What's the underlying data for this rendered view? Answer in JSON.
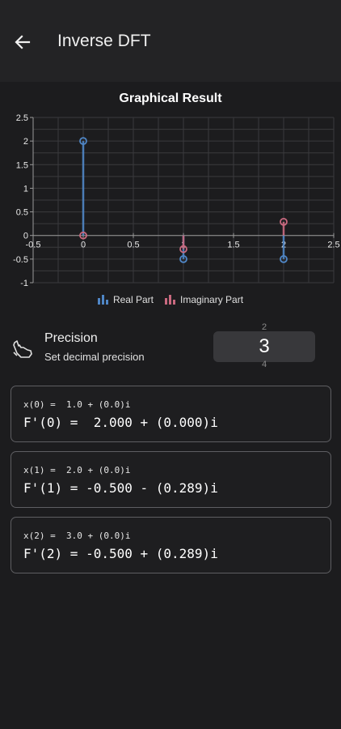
{
  "app_bar": {
    "title": "Inverse DFT",
    "back_icon": "arrow-left-icon"
  },
  "chart_section": {
    "title": "Graphical Result"
  },
  "chart_data": {
    "type": "scatter",
    "title": "Graphical Result",
    "x_ticks": [
      "-0.5",
      "0",
      "0.5",
      "1",
      "1.5",
      "2",
      "2.5"
    ],
    "y_ticks": [
      "-1",
      "-0.5",
      "0",
      "0.5",
      "1",
      "1.5",
      "2",
      "2.5"
    ],
    "xlim": [
      -0.5,
      2.5
    ],
    "ylim": [
      -1,
      2.5
    ],
    "grid": true,
    "legend_position": "bottom",
    "series": [
      {
        "name": "Real Part",
        "color": "#4f86c6",
        "x": [
          0,
          1,
          2
        ],
        "y": [
          2.0,
          -0.5,
          -0.5
        ]
      },
      {
        "name": "Imaginary Part",
        "color": "#c9697f",
        "x": [
          0,
          1,
          2
        ],
        "y": [
          0.0,
          -0.289,
          0.289
        ]
      }
    ]
  },
  "precision": {
    "icon": "hand-pointing-icon",
    "title": "Precision",
    "subtitle": "Set decimal precision",
    "prev_value": "2",
    "value": "3",
    "next_value": "4"
  },
  "results": [
    {
      "input": "x(0) =  1.0 + (0.0)i",
      "output": "F'(0) =  2.000 + (0.000)i"
    },
    {
      "input": "x(1) =  2.0 + (0.0)i",
      "output": "F'(1) = -0.500 - (0.289)i"
    },
    {
      "input": "x(2) =  3.0 + (0.0)i",
      "output": "F'(2) = -0.500 + (0.289)i"
    }
  ]
}
